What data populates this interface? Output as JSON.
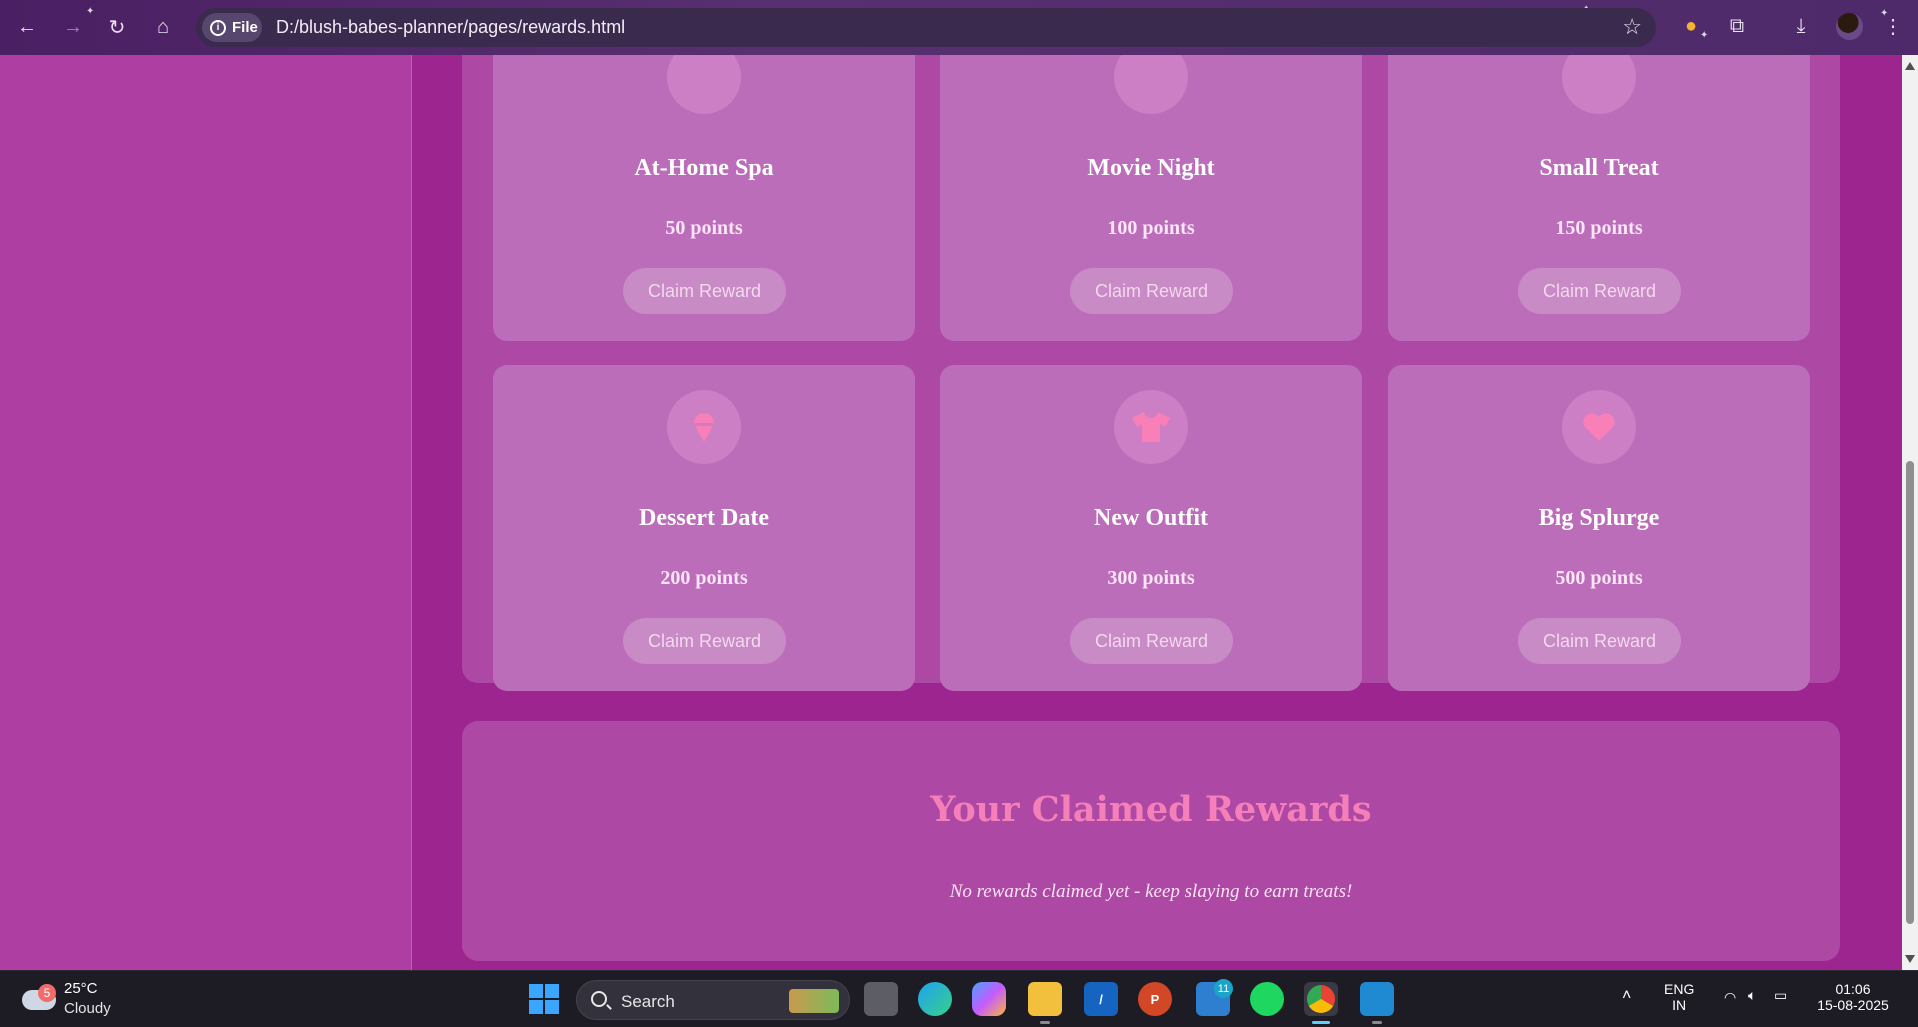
{
  "browser": {
    "file_chip": "File",
    "url": "D:/blush-babes-planner/pages/rewards.html"
  },
  "rewards": [
    {
      "name": "At-Home Spa",
      "points": "50 points",
      "button": "Claim Reward",
      "icon": "spa-icon"
    },
    {
      "name": "Movie Night",
      "points": "100 points",
      "button": "Claim Reward",
      "icon": "film-icon"
    },
    {
      "name": "Small Treat",
      "points": "150 points",
      "button": "Claim Reward",
      "icon": "candy-icon"
    },
    {
      "name": "Dessert Date",
      "points": "200 points",
      "button": "Claim Reward",
      "icon": "ice-cream-icon"
    },
    {
      "name": "New Outfit",
      "points": "300 points",
      "button": "Claim Reward",
      "icon": "shirt-icon"
    },
    {
      "name": "Big Splurge",
      "points": "500 points",
      "button": "Claim Reward",
      "icon": "heart-icon"
    }
  ],
  "claimed": {
    "title": "Your Claimed Rewards",
    "empty_message": "No rewards claimed yet - keep slaying to earn treats!"
  },
  "colors": {
    "page_bg": "#9c2590",
    "card_bg": "#bb6db9",
    "accent_pink": "#f47fb9"
  },
  "taskbar": {
    "weather_badge": "5",
    "temperature": "25°C",
    "condition": "Cloudy",
    "search_label": "Search",
    "notification_badge": "11",
    "language_top": "ENG",
    "language_bottom": "IN",
    "time": "01:06",
    "date": "15-08-2025"
  }
}
